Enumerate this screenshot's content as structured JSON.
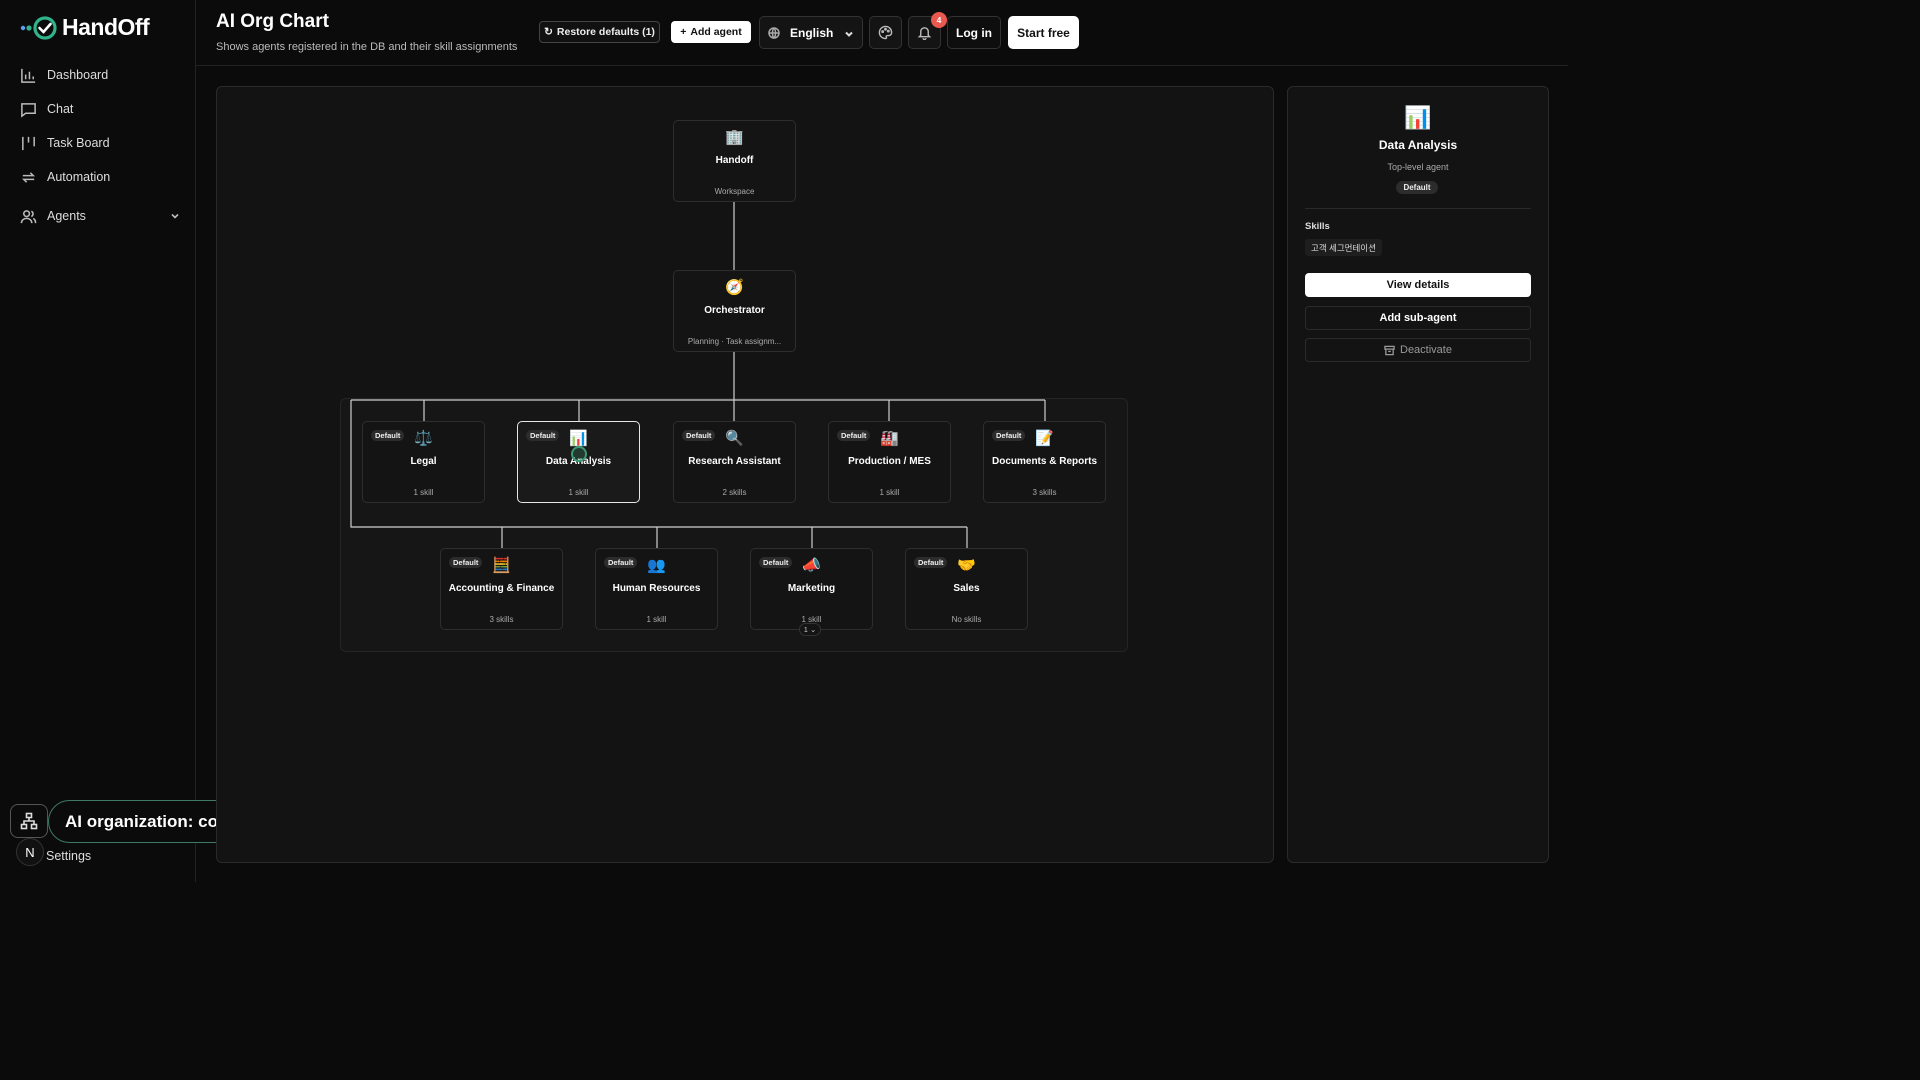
{
  "app": {
    "logo_text": "HandOff",
    "accent": "#2fb38a"
  },
  "sidebar": {
    "items": [
      {
        "label": "Dashboard",
        "icon": "bar-chart-icon"
      },
      {
        "label": "Chat",
        "icon": "message-icon"
      },
      {
        "label": "Task Board",
        "icon": "kanban-icon"
      },
      {
        "label": "Automation",
        "icon": "repeat-icon"
      },
      {
        "label": "Agents",
        "icon": "users-icon"
      }
    ],
    "settings_label": "Settings",
    "avatar_initial": "N"
  },
  "tooltip": {
    "text": "AI organization: connected agents and tools"
  },
  "header": {
    "title": "AI Org Chart",
    "subtitle": "Shows agents registered in the DB and their skill assignments",
    "restore_label": "Restore defaults (1)",
    "add_agent_label": "Add agent",
    "language": "English",
    "notification_count": "4",
    "login_label": "Log in",
    "start_label": "Start free"
  },
  "org": {
    "root": {
      "icon": "🏢",
      "name": "Handoff",
      "sub": "Workspace"
    },
    "orchestrator": {
      "icon": "🧭",
      "name": "Orchestrator",
      "sub": "Planning · Task assignm..."
    },
    "default_badge": "Default",
    "row1": [
      {
        "icon": "⚖️",
        "name": "Legal",
        "sub": "1 skill"
      },
      {
        "icon": "📊",
        "name": "Data Analysis",
        "sub": "1 skill",
        "selected": true
      },
      {
        "icon": "🔍",
        "name": "Research Assistant",
        "sub": "2 skills"
      },
      {
        "icon": "🏭",
        "name": "Production / MES",
        "sub": "1 skill"
      },
      {
        "icon": "📝",
        "name": "Documents & Reports",
        "sub": "3 skills"
      }
    ],
    "row2": [
      {
        "icon": "🧮",
        "name": "Accounting & Finance",
        "sub": "3 skills"
      },
      {
        "icon": "👥",
        "name": "Human Resources",
        "sub": "1 skill"
      },
      {
        "icon": "📣",
        "name": "Marketing",
        "sub": "1 skill"
      },
      {
        "icon": "🤝",
        "name": "Sales",
        "sub": "No skills"
      }
    ],
    "expander_label": "1 ⌄"
  },
  "panel": {
    "icon": "📊",
    "title": "Data Analysis",
    "subtitle": "Top-level agent",
    "badge": "Default",
    "skills_label": "Skills",
    "skills": [
      "고객 세그먼테이션"
    ],
    "view_details": "View details",
    "add_sub_agent": "Add sub-agent",
    "deactivate": "Deactivate"
  }
}
